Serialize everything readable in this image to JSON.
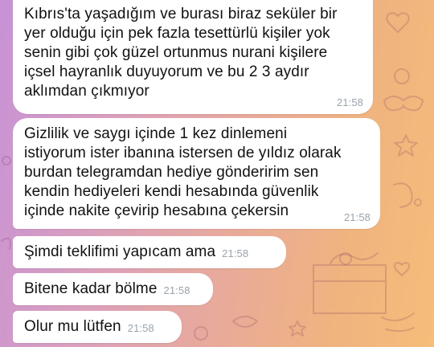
{
  "chat": {
    "messages": [
      {
        "text": "Kıbrıs'ta yaşadığım ve burası biraz seküler bir\nyer olduğu için pek fazla tesettürlü kişiler yok\nsenin gibi çok güzel ortunmus nurani kişilere\niçsel hayranlık duyuyorum ve bu 2 3 aydır\naklımdan çıkmıyor",
        "time": "21:58"
      },
      {
        "text": "Gizlilik ve saygı içinde 1 kez dinlemeni\nistiyorum ister ibanına istersen de yıldız olarak\nburdan telegramdan hediye gönderirim sen\nkendin hediyeleri kendi hesabında güvenlik\niçinde nakite çevirip hesabına çekersin",
        "time": "21:58"
      },
      {
        "text": "Şimdi teklifimi yapıcam ama",
        "time": "21:58"
      },
      {
        "text": "Bitene kadar bölme",
        "time": "21:58"
      },
      {
        "text": "Olur mu lütfen",
        "time": "21:58"
      }
    ]
  },
  "colors": {
    "bubble": "#ffffff",
    "timestamp": "#9aa3ab",
    "wallpaper_start": "#c792d6",
    "wallpaper_end": "#f5bd7a"
  }
}
